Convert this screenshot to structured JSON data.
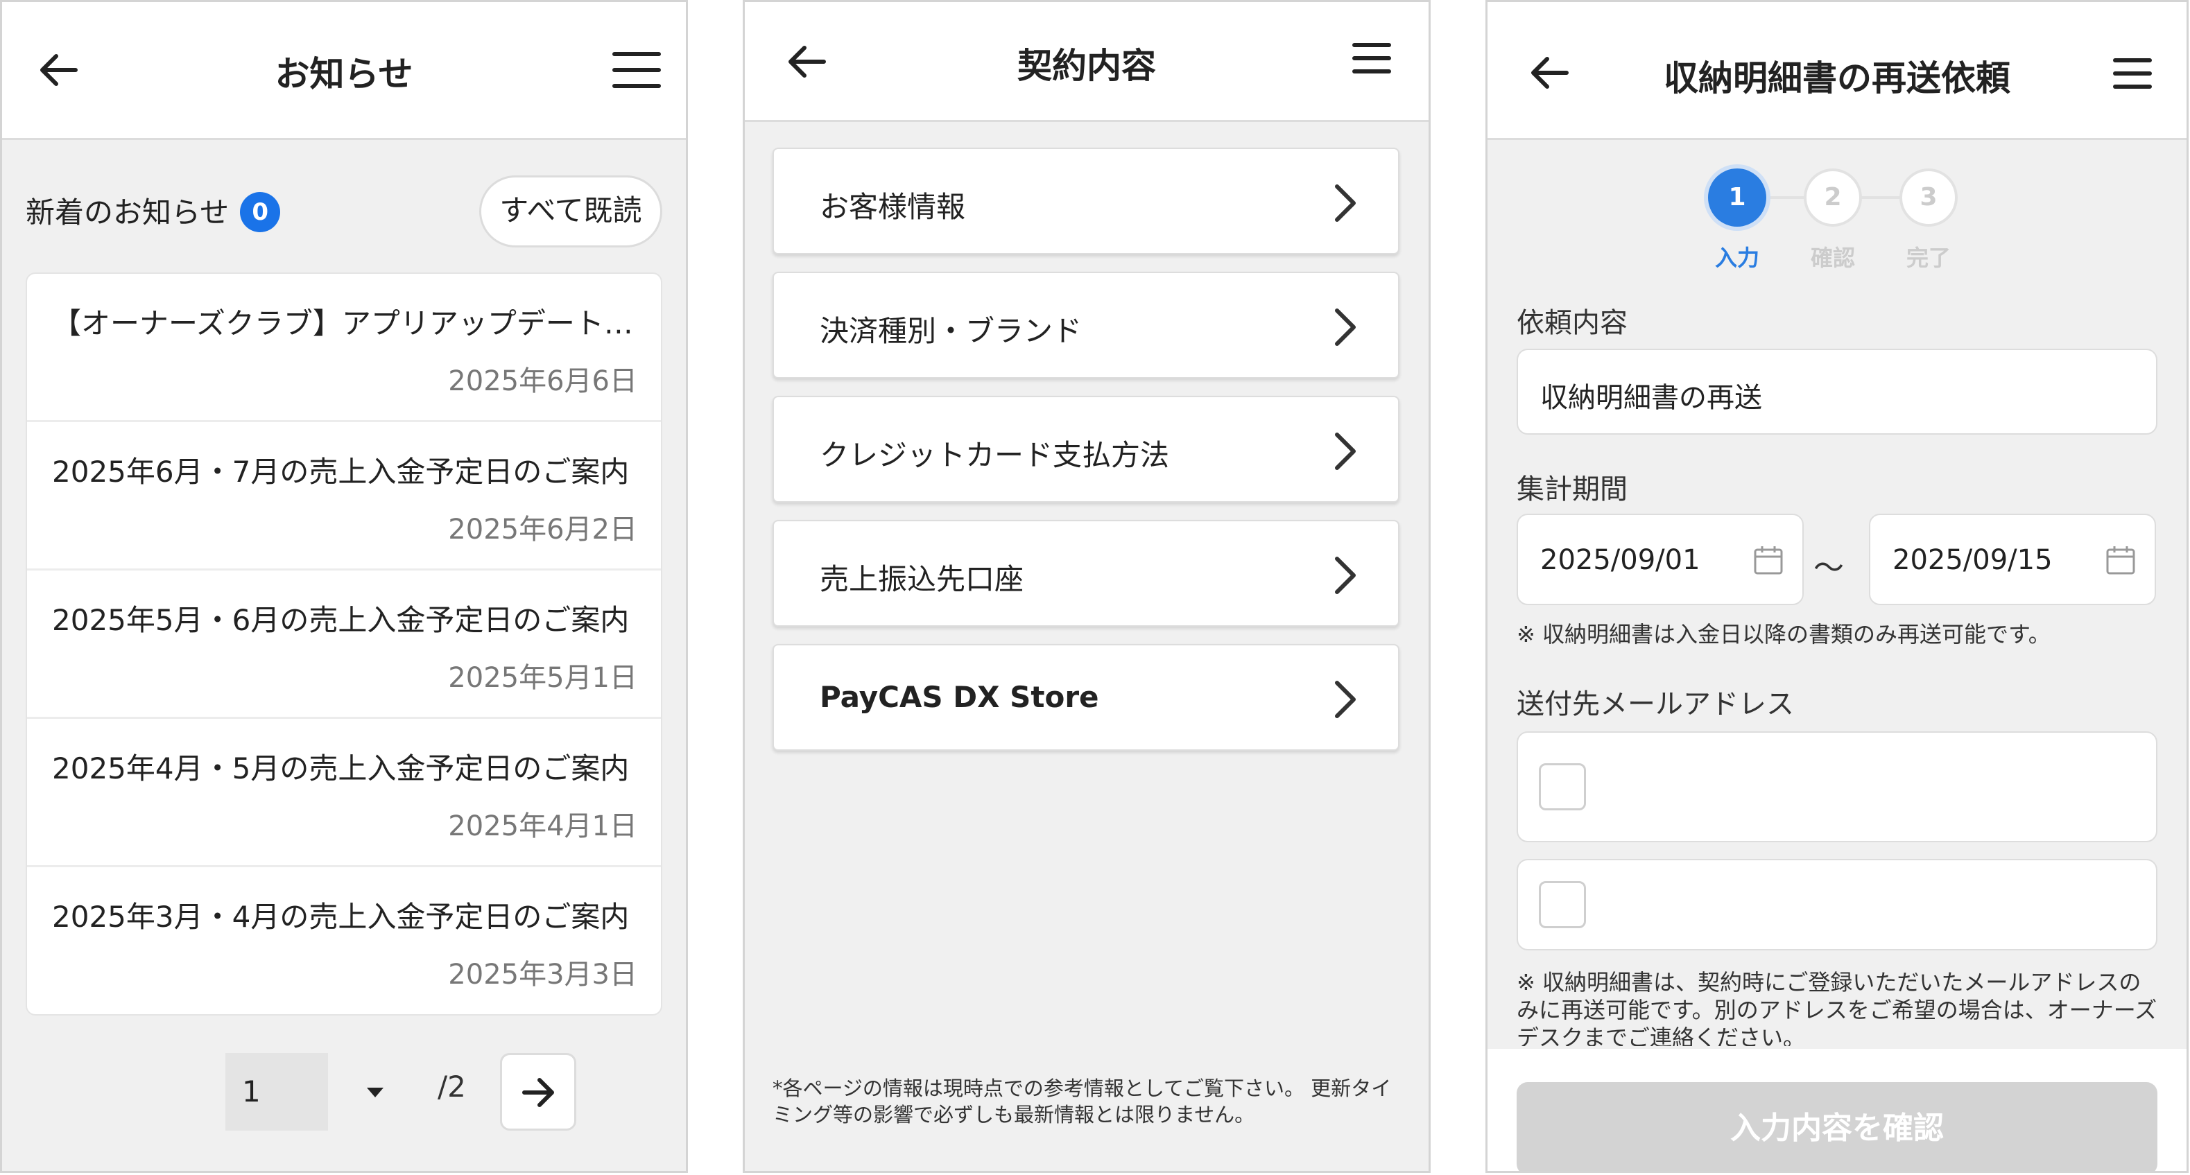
{
  "screen1": {
    "title": "お知らせ",
    "news_header": "新着のお知らせ",
    "unread_count": "0",
    "mark_all_read": "すべて既読",
    "items": [
      {
        "title": "【オーナーズクラブ】アプリアップデート…",
        "date": "2025年6月6日"
      },
      {
        "title": "2025年6月・7月の売上入金予定日のご案内",
        "date": "2025年6月2日"
      },
      {
        "title": "2025年5月・6月の売上入金予定日のご案内",
        "date": "2025年5月1日"
      },
      {
        "title": "2025年4月・5月の売上入金予定日のご案内",
        "date": "2025年4月1日"
      },
      {
        "title": "2025年3月・4月の売上入金予定日のご案内",
        "date": "2025年3月3日"
      }
    ],
    "pager": {
      "current": "1",
      "total": "/2"
    }
  },
  "screen2": {
    "title": "契約内容",
    "items": [
      {
        "label": "お客様情報"
      },
      {
        "label": "決済種別・ブランド"
      },
      {
        "label": "クレジットカード支払方法"
      },
      {
        "label": "売上振込先口座"
      },
      {
        "label": "PayCAS DX Store"
      }
    ],
    "note": "*各ページの情報は現時点での参考情報としてご覧下さい。 更新タイミング等の影響で必ずしも最新情報とは限りません。"
  },
  "screen3": {
    "title": "収納明細書の再送依頼",
    "steps": [
      {
        "num": "1",
        "label": "入力"
      },
      {
        "num": "2",
        "label": "確認"
      },
      {
        "num": "3",
        "label": "完了"
      }
    ],
    "request_label": "依頼内容",
    "request_value": "収納明細書の再送",
    "period_label": "集計期間",
    "period_from": "2025/09/01",
    "period_tilde": "～",
    "period_to": "2025/09/15",
    "period_note": "※ 収納明細書は入金日以降の書類のみ再送可能です。",
    "email_label": "送付先メールアドレス",
    "email_note": "※ 収納明細書は、契約時にご登録いただいたメールアドレスのみに再送可能です。別のアドレスをご希望の場合は、オーナーズデスクまでご連絡ください。",
    "confirm_button": "入力内容を確認"
  },
  "colors": {
    "accent": "#2a7de1",
    "badge": "#1a73e8",
    "disabled_button": "#d3d3d3"
  }
}
